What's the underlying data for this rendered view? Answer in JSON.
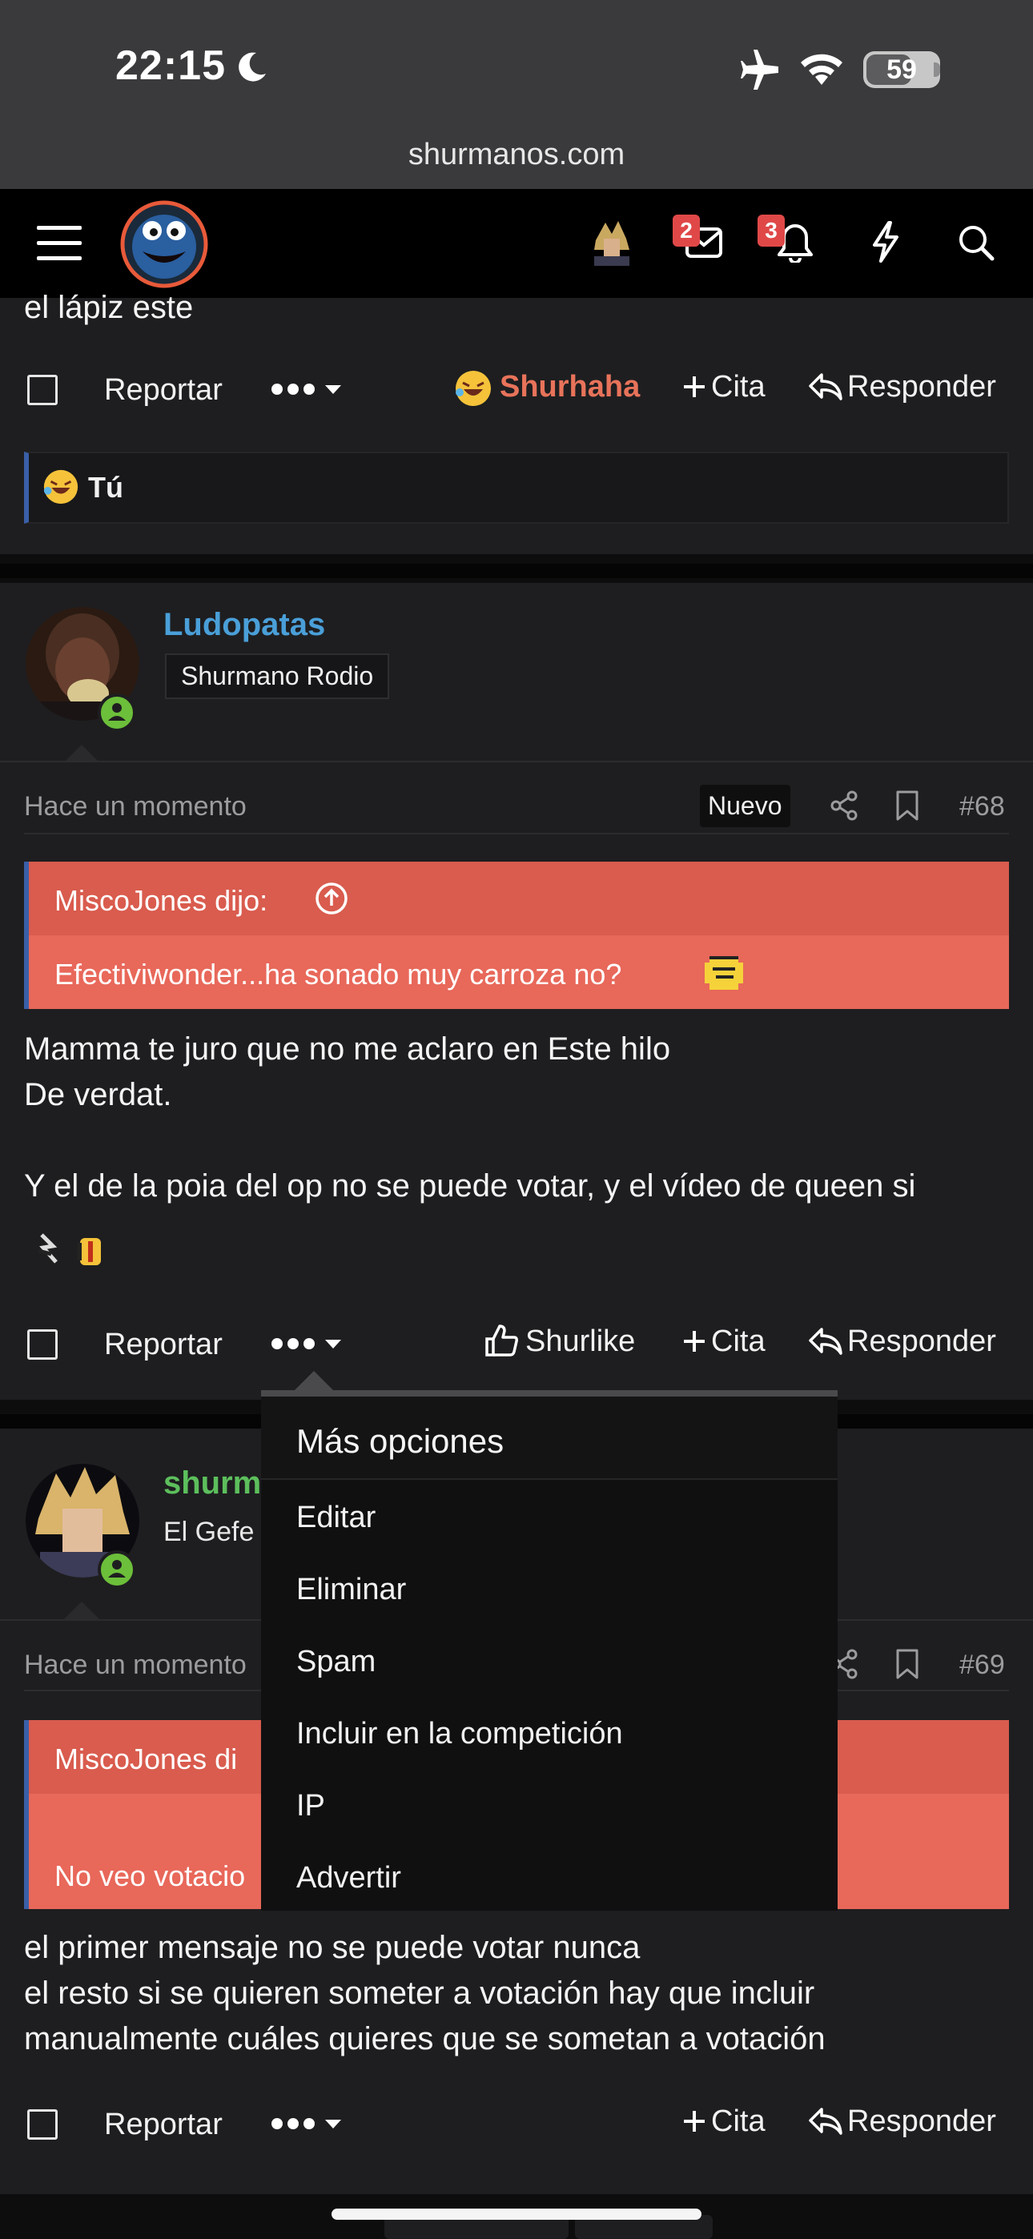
{
  "status": {
    "time": "22:15",
    "battery": "59",
    "url": "shurmanos.com"
  },
  "nav": {
    "messages_count": "2",
    "alerts_count": "3",
    "icons": [
      "menu-icon",
      "site-logo",
      "user-avatar",
      "envelope-icon",
      "bell-icon",
      "lightning-icon",
      "search-icon"
    ]
  },
  "post_prev": {
    "content_tail": "el lápiz este",
    "report_label": "Reportar",
    "reaction_label": "Shurhaha",
    "quote_label": "Cita",
    "reply_label": "Responder",
    "reactions_by": "Tú"
  },
  "post68": {
    "username": "Ludopatas",
    "user_title": "Shurmano Rodio",
    "time": "Hace un momento",
    "new_badge": "Nuevo",
    "number": "#68",
    "quote_author": "MiscoJones dijo:",
    "quote_text": "Efectiviwonder...ha sonado muy carroza no?",
    "content_lines": [
      "Mamma te juro que no me aclaro en Este hilo",
      "De verdat.",
      "",
      "Y el de la poia del op no se puede votar, y el vídeo de queen si"
    ],
    "report_label": "Reportar",
    "like_label": "Shurlike",
    "quote_label": "Cita",
    "reply_label": "Responder"
  },
  "post69": {
    "username": "shurm",
    "user_title": "El Gefe",
    "time": "Hace un momento",
    "number": "#69",
    "quote_author": "MiscoJones di",
    "quote_text": "No veo votacio",
    "content_lines": [
      "el primer mensaje no se puede votar nunca",
      "el resto si se quieren someter a votación hay que incluir",
      "manualmente cuáles quieres que se sometan a votación"
    ],
    "report_label": "Reportar",
    "quote_label": "Cita",
    "reply_label": "Responder"
  },
  "menu": {
    "title": "Más opciones",
    "items": [
      "Editar",
      "Eliminar",
      "Spam",
      "Incluir en la competición",
      "IP",
      "Advertir"
    ]
  },
  "colors": {
    "username_blue": "#4a9fd8",
    "username_green": "#5cbf5c",
    "reaction_orange": "#e8735a",
    "quote_head": "#d95c4e",
    "quote_body": "#e8685a"
  }
}
